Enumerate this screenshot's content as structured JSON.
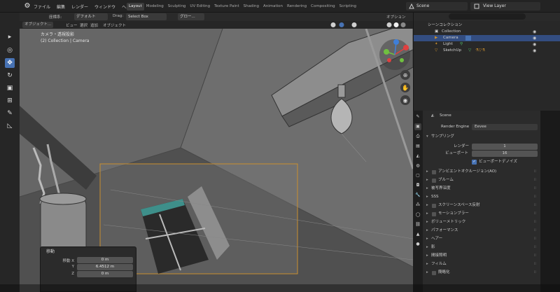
{
  "topbar": {
    "menus": [
      "ファイル",
      "編集",
      "レンダー",
      "ウィンドウ",
      "ヘルプ"
    ],
    "workspaces": [
      {
        "label": "Layout",
        "active": true
      },
      {
        "label": "Modeling"
      },
      {
        "label": "Sculpting"
      },
      {
        "label": "UV Editing"
      },
      {
        "label": "Texture Paint"
      },
      {
        "label": "Shading"
      },
      {
        "label": "Animation"
      },
      {
        "label": "Rendering"
      },
      {
        "label": "Compositing"
      },
      {
        "label": "Scripting"
      }
    ],
    "scene": "Scene",
    "view_layer": "View Layer"
  },
  "toolheader": {
    "mode_label": "座標系:",
    "orientation": "デフォルト",
    "drag_label": "Drag:",
    "drag_value": "Select Box",
    "transform_pivot": "グロー...",
    "options": "オプション"
  },
  "vpheader": {
    "mode": "オブジェクト...",
    "menus": [
      "ビュー",
      "選択",
      "追加",
      "オブジェクト"
    ]
  },
  "viewport": {
    "camera_line1": "カメラ・透視投影",
    "camera_line2": "(2) Collection | Camera"
  },
  "op_panel": {
    "title": "移動",
    "rows": [
      {
        "key": "移動 X",
        "value": "0 m"
      },
      {
        "key": "Y",
        "value": "6.4512 m"
      },
      {
        "key": "Z",
        "value": "0 m"
      }
    ]
  },
  "outliner": {
    "root": "シーンコレクション",
    "collection": "Collection",
    "items": [
      {
        "label": "Camera",
        "selected": true
      },
      {
        "label": "Light"
      },
      {
        "label": "SketchUp"
      }
    ]
  },
  "properties": {
    "scene_label": "Scene",
    "render_engine_label": "Render Engine",
    "render_engine": "Eevee",
    "sampling": "サンプリング",
    "render_label": "レンダー",
    "render_value": "1",
    "viewport_label": "ビューポート",
    "viewport_value": "16",
    "viewport_denoise": "ビューポートデノイズ",
    "sections": [
      {
        "label": "アンビエントオクルージョン(AO)",
        "checkbox": true
      },
      {
        "label": "ブルーム",
        "checkbox": true
      },
      {
        "label": "被写界深度",
        "checkbox": false
      },
      {
        "label": "SSS",
        "checkbox": false
      },
      {
        "label": "スクリーンスペース反射",
        "checkbox": true
      },
      {
        "label": "モーションブラー",
        "checkbox": true
      },
      {
        "label": "ボリューメトリック",
        "checkbox": false
      },
      {
        "label": "パフォーマンス",
        "checkbox": false
      },
      {
        "label": "ヘアー",
        "checkbox": false
      },
      {
        "label": "影",
        "checkbox": false
      },
      {
        "label": "間接照明",
        "checkbox": false
      },
      {
        "label": "フィルム",
        "checkbox": false
      },
      {
        "label": "簡略化",
        "checkbox": true
      }
    ]
  },
  "colors": {
    "accent": "#4772b3",
    "selection": "#334d80",
    "camera_frame": "#c98f2f",
    "window_frame": "#3e8f8a"
  }
}
